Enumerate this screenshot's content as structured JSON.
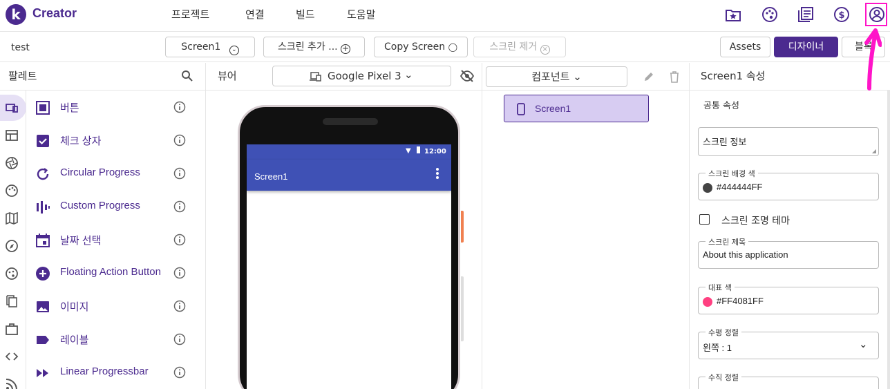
{
  "app": {
    "logo_letter": "k",
    "name": "Creator"
  },
  "menu": [
    "프로젝트",
    "연결",
    "빌드",
    "도움말"
  ],
  "toolbar_icons": [
    "project-star-icon",
    "palette-icon",
    "docs-icon",
    "dollar-icon",
    "account-icon"
  ],
  "project": {
    "name": "test",
    "screen_select": "Screen1",
    "add_screen": "스크린 추가 ...",
    "copy_screen": "Copy Screen",
    "remove_screen": "스크린 제거",
    "assets": "Assets",
    "designer": "디자이너",
    "blocks": "블록"
  },
  "palette": {
    "title": "팔레트",
    "items": [
      {
        "label": "버튼",
        "icon": "button-icon"
      },
      {
        "label": "체크 상자",
        "icon": "checkbox-icon"
      },
      {
        "label": "Circular Progress",
        "icon": "circular-progress-icon"
      },
      {
        "label": "Custom Progress",
        "icon": "custom-progress-icon"
      },
      {
        "label": "날짜 선택",
        "icon": "date-picker-icon"
      },
      {
        "label": "Floating Action Button",
        "icon": "fab-icon"
      },
      {
        "label": "이미지",
        "icon": "image-icon"
      },
      {
        "label": "레이블",
        "icon": "label-icon"
      },
      {
        "label": "Linear Progressbar",
        "icon": "linear-progress-icon"
      }
    ]
  },
  "viewer": {
    "title": "뷰어",
    "device": "Google Pixel 3",
    "time": "12:00",
    "screen_title": "Screen1"
  },
  "components": {
    "title": "컴포넌트",
    "tree": [
      "Screen1"
    ]
  },
  "properties": {
    "title": "Screen1 속성",
    "section": "공통 속성",
    "about_screen": "스크린 정보",
    "background_color_label": "스크린 배경 색",
    "background_color_value": "#444444FF",
    "background_color_hex": "#444444",
    "theme_checkbox": "스크린 조명 테마",
    "title_label": "스크린 제목",
    "title_value": "About this application",
    "accent_label": "대표 색",
    "accent_value": "#FF4081FF",
    "accent_hex": "#FF4081",
    "align_h_label": "수평 정렬",
    "align_h_value": "왼쪽 : 1",
    "align_v_label": "수직 정렬"
  },
  "colors": {
    "brand": "#4b2a8f",
    "highlight": "#ff14c8",
    "app_bar": "#3f51b5",
    "component_selected": "#d7ccf2"
  }
}
